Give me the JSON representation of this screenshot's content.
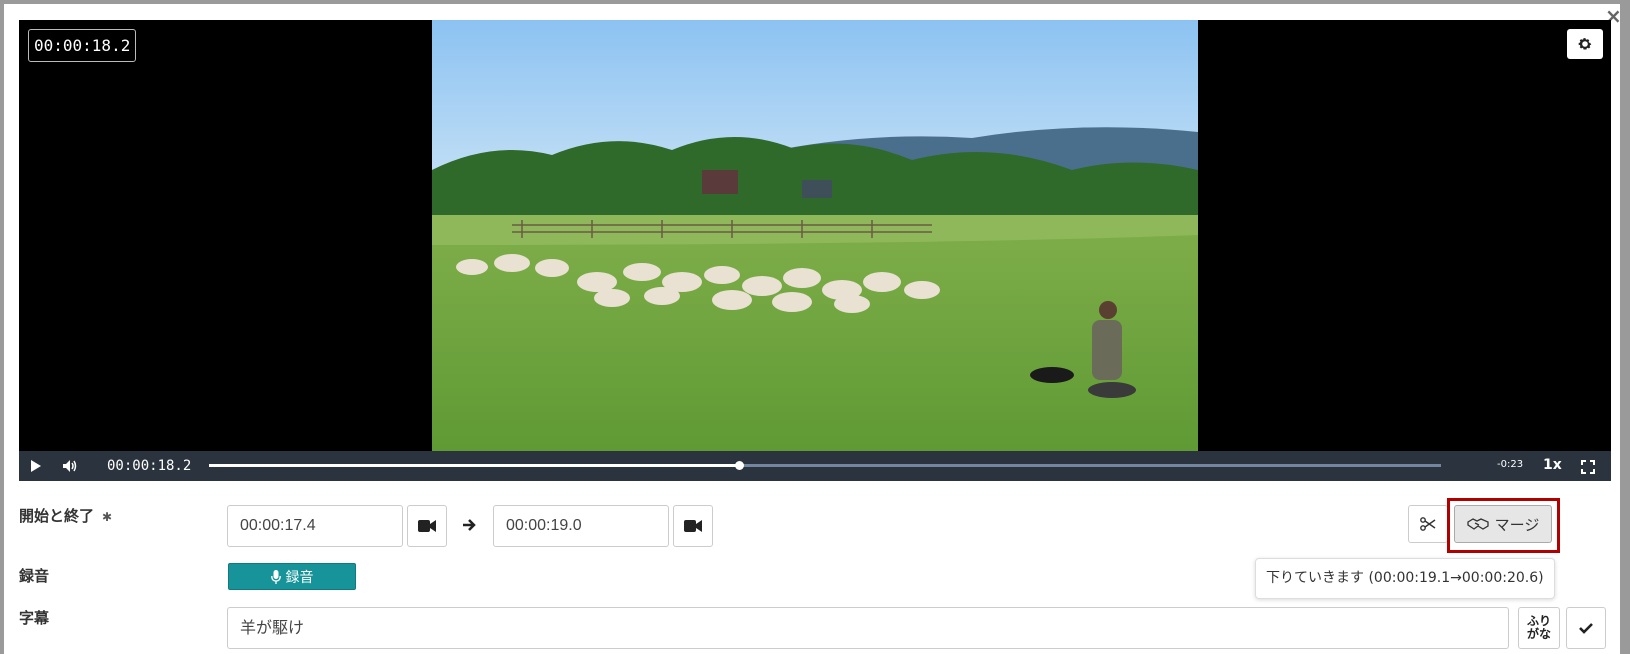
{
  "player": {
    "overlay_time": "00:00:18.2",
    "current_time": "00:00:18.2",
    "remaining": "-0:23",
    "playback_rate": "1x",
    "progress": 0.43,
    "icons": [
      "settings-icon",
      "play-icon",
      "volume-icon",
      "fullscreen-icon"
    ]
  },
  "form": {
    "start_end_label": "開始と終了",
    "required_mark": "✱",
    "start_time": "00:00:17.4",
    "end_time": "00:00:19.0",
    "recording_label": "録音",
    "record_button": "録音",
    "subtitle_label": "字幕",
    "subtitle_value": "羊が駆け",
    "merge_button": "マージ",
    "merge_tooltip": "下りていきます (00:00:19.1→00:00:20.6)",
    "furigana_top": "ふり",
    "furigana_bottom": "がな"
  },
  "colors": {
    "record_button": "#17949a",
    "highlight": "#b00000",
    "control_bar": "#2b333f"
  }
}
